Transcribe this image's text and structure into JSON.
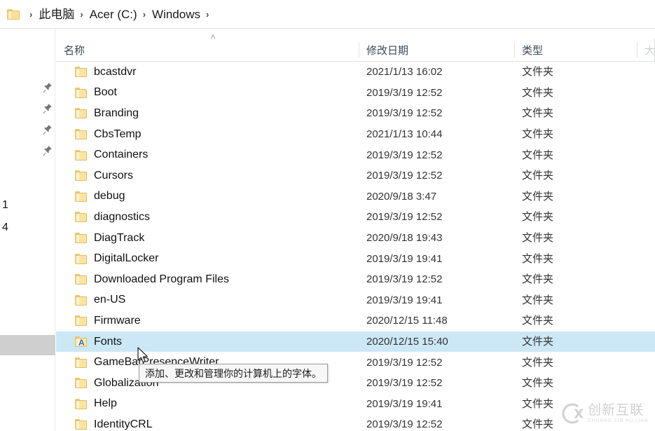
{
  "address_bar": {
    "folder_icon": "folder-icon",
    "separator": "›",
    "crumbs": [
      {
        "label": "此电脑"
      },
      {
        "label": "Acer (C:)"
      },
      {
        "label": "Windows"
      }
    ]
  },
  "left_rail": {
    "pin_icon": "pin-icon",
    "pin_count": 4,
    "fragments": [
      {
        "text": "1"
      },
      {
        "text": "4"
      }
    ]
  },
  "columns": {
    "sort_indicator": "˄",
    "headers": [
      {
        "label": "名称",
        "key": "name"
      },
      {
        "label": "修改日期",
        "key": "date"
      },
      {
        "label": "类型",
        "key": "type"
      },
      {
        "label": "大",
        "key": "size_partial"
      }
    ]
  },
  "file_list": {
    "rows": [
      {
        "name": "bcastdvr",
        "date": "2021/1/13 16:02",
        "type": "文件夹",
        "icon": "folder-icon",
        "selected": false
      },
      {
        "name": "Boot",
        "date": "2019/3/19 12:52",
        "type": "文件夹",
        "icon": "folder-icon",
        "selected": false
      },
      {
        "name": "Branding",
        "date": "2019/3/19 12:52",
        "type": "文件夹",
        "icon": "folder-icon",
        "selected": false
      },
      {
        "name": "CbsTemp",
        "date": "2021/1/13 10:44",
        "type": "文件夹",
        "icon": "folder-icon",
        "selected": false
      },
      {
        "name": "Containers",
        "date": "2019/3/19 12:52",
        "type": "文件夹",
        "icon": "folder-icon",
        "selected": false
      },
      {
        "name": "Cursors",
        "date": "2019/3/19 12:52",
        "type": "文件夹",
        "icon": "folder-icon",
        "selected": false
      },
      {
        "name": "debug",
        "date": "2020/9/18 3:47",
        "type": "文件夹",
        "icon": "folder-icon",
        "selected": false
      },
      {
        "name": "diagnostics",
        "date": "2019/3/19 12:52",
        "type": "文件夹",
        "icon": "folder-icon",
        "selected": false
      },
      {
        "name": "DiagTrack",
        "date": "2020/9/18 19:43",
        "type": "文件夹",
        "icon": "folder-icon",
        "selected": false
      },
      {
        "name": "DigitalLocker",
        "date": "2019/3/19 19:41",
        "type": "文件夹",
        "icon": "folder-icon",
        "selected": false
      },
      {
        "name": "Downloaded Program Files",
        "date": "2019/3/19 12:52",
        "type": "文件夹",
        "icon": "folder-icon",
        "selected": false
      },
      {
        "name": "en-US",
        "date": "2019/3/19 19:41",
        "type": "文件夹",
        "icon": "folder-icon",
        "selected": false
      },
      {
        "name": "Firmware",
        "date": "2020/12/15 11:48",
        "type": "文件夹",
        "icon": "folder-icon",
        "selected": false
      },
      {
        "name": "Fonts",
        "date": "2020/12/15 15:40",
        "type": "文件夹",
        "icon": "fonts-folder-icon",
        "selected": true
      },
      {
        "name": "GameBarPresenceWriter",
        "date": "2019/3/19 12:52",
        "type": "文件夹",
        "icon": "folder-icon",
        "selected": false
      },
      {
        "name": "Globalization",
        "date": "2019/3/19 12:52",
        "type": "文件夹",
        "icon": "folder-icon",
        "selected": false
      },
      {
        "name": "Help",
        "date": "2019/3/19 19:41",
        "type": "文件夹",
        "icon": "folder-icon",
        "selected": false
      },
      {
        "name": "IdentityCRL",
        "date": "2019/3/19 12:52",
        "type": "文件夹",
        "icon": "folder-icon",
        "selected": false
      }
    ]
  },
  "tooltip": {
    "text": "添加、更改和管理你的计算机上的字体。"
  },
  "cursor": {
    "icon": "mouse-pointer-icon"
  },
  "watermark": {
    "logo": "cx-logo-icon",
    "chinese": "创新互联",
    "pinyin": "CHUANG XIN HU LIAN"
  },
  "colors": {
    "selection": "#cce8f6",
    "folder_fill": "#fbe3a2",
    "folder_stroke": "#e0bd63",
    "header_text": "#3b4a5a",
    "rail_selected": "#cfcfcf"
  }
}
